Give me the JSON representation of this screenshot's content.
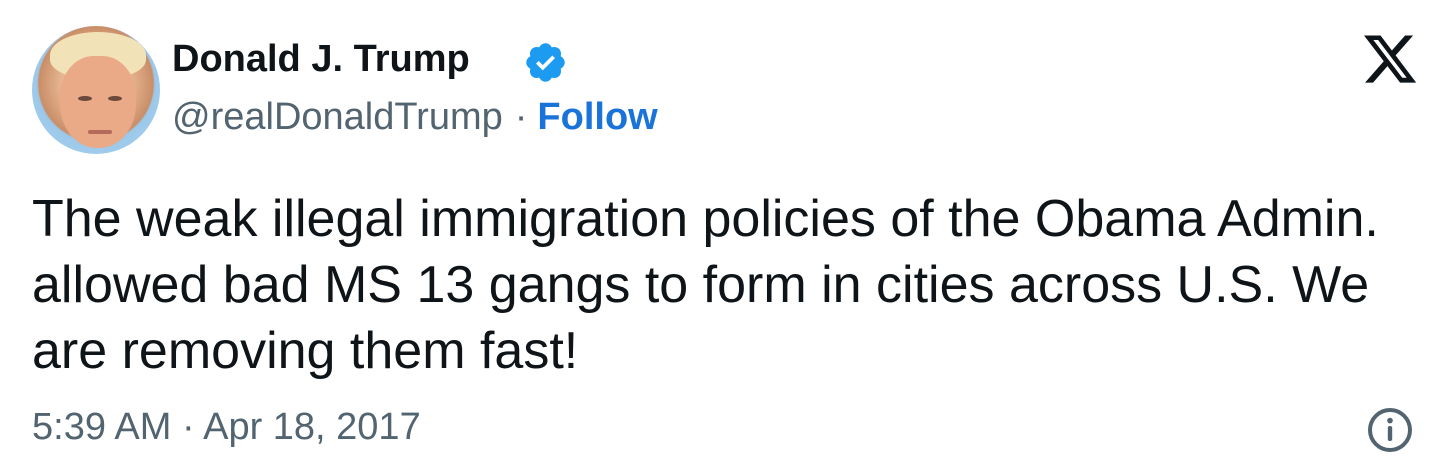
{
  "author": {
    "name": "Donald J. Trump",
    "handle": "@realDonaldTrump",
    "separator": "·",
    "follow_label": "Follow",
    "verified_icon": "verified-badge-icon",
    "avatar": "avatar-portrait"
  },
  "platform_logo": "x-logo-icon",
  "tweet": {
    "text": "The weak illegal immigration policies of the Obama Admin. allowed bad MS 13 gangs to form in cities across U.S. We are removing them fast!",
    "timestamp": "5:39 AM · Apr 18, 2017"
  },
  "info_icon": "info-icon",
  "colors": {
    "text": "#0f1419",
    "secondary": "#536471",
    "accent": "#1a73d9",
    "verified": "#1d9bf0"
  }
}
